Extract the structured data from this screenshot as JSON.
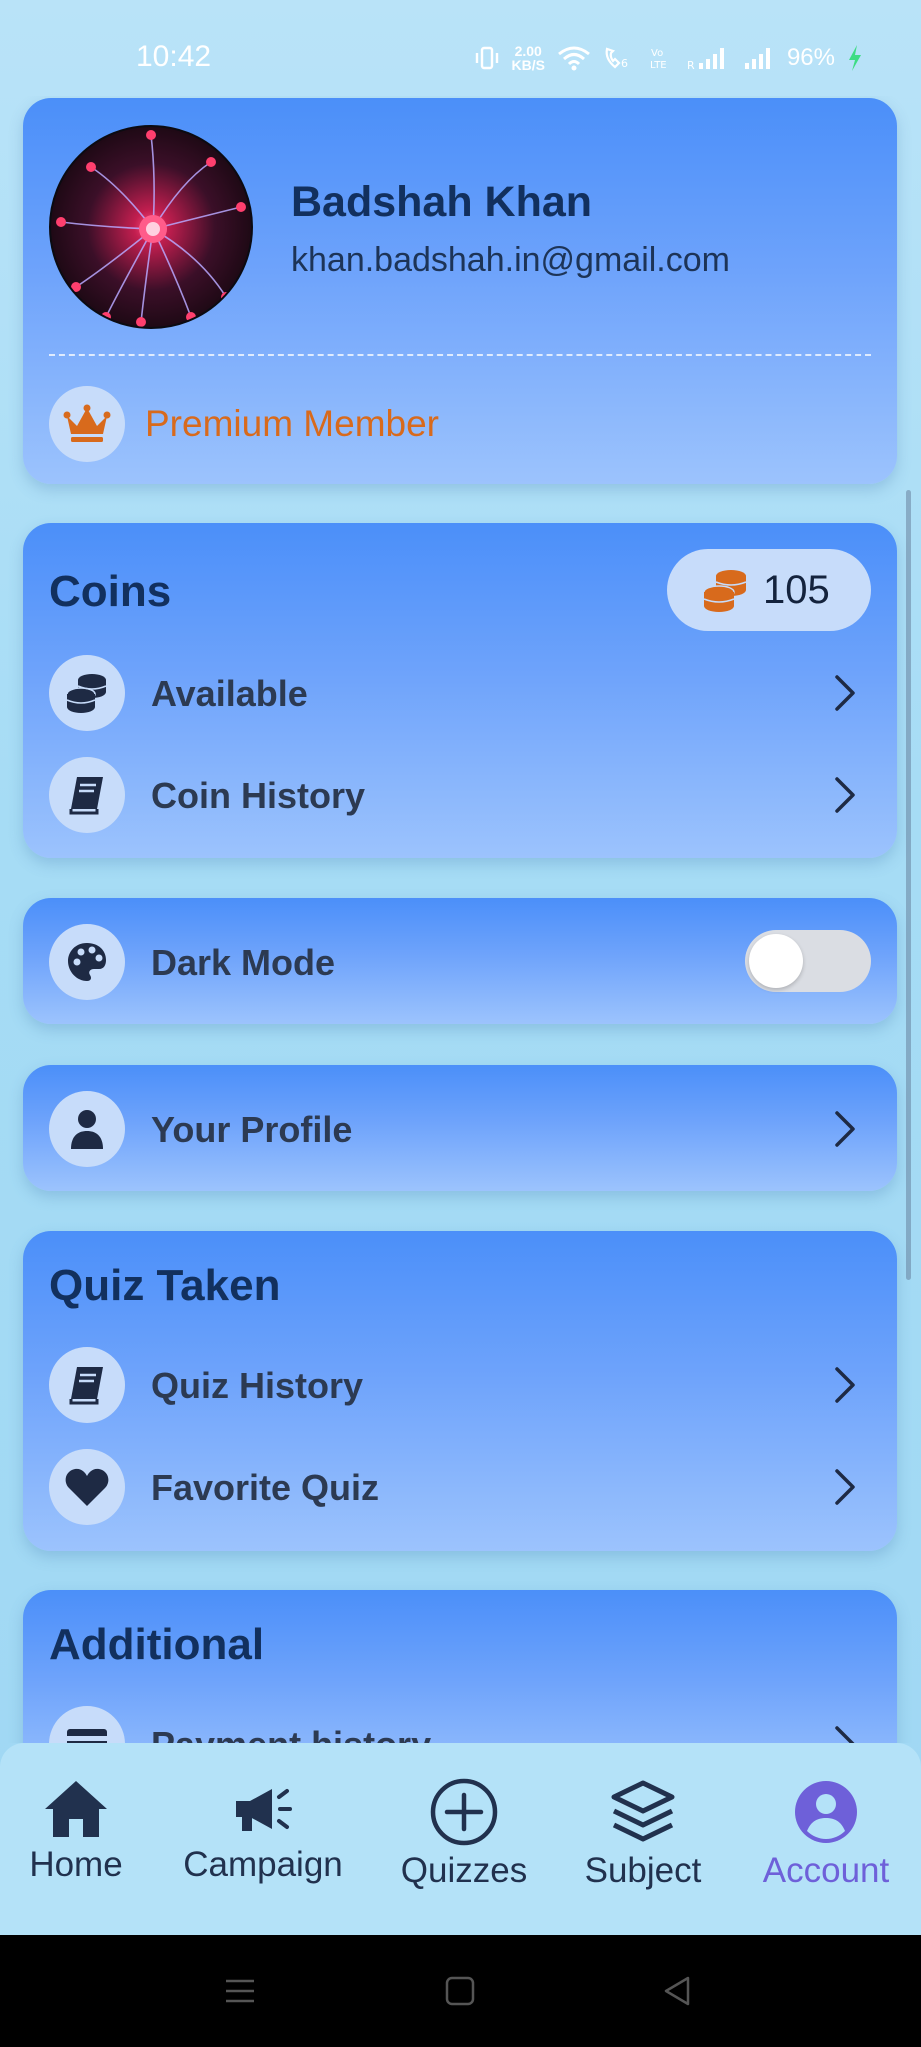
{
  "status_bar": {
    "time": "10:42",
    "net_speed_value": "2.00",
    "net_speed_unit": "KB/S",
    "battery": "96%"
  },
  "profile": {
    "name": "Badshah Khan",
    "email": "khan.badshah.in@gmail.com",
    "membership": "Premium Member",
    "membership_icon": "crown-icon"
  },
  "coins": {
    "title": "Coins",
    "count": "105",
    "items": [
      {
        "label": "Available",
        "icon": "coins-stack-icon"
      },
      {
        "label": "Coin History",
        "icon": "book-icon"
      }
    ]
  },
  "appearance": {
    "dark_mode_label": "Dark Mode",
    "dark_mode_on": false,
    "icon": "palette-icon"
  },
  "account": {
    "profile_label": "Your Profile",
    "icon": "user-icon"
  },
  "quiz": {
    "title": "Quiz Taken",
    "items": [
      {
        "label": "Quiz History",
        "icon": "book-icon"
      },
      {
        "label": "Favorite Quiz",
        "icon": "heart-icon"
      }
    ]
  },
  "additional": {
    "title": "Additional",
    "items": [
      {
        "label": "Payment history",
        "icon": "card-icon"
      }
    ]
  },
  "bottom_nav": {
    "items": [
      {
        "label": "Home",
        "icon": "home-icon"
      },
      {
        "label": "Campaign",
        "icon": "megaphone-icon"
      },
      {
        "label": "Quizzes",
        "icon": "plus-circle-icon"
      },
      {
        "label": "Subject",
        "icon": "layers-icon"
      },
      {
        "label": "Account",
        "icon": "account-circle-icon"
      }
    ],
    "active": "Account",
    "active_color": "#6e60d9"
  },
  "colors": {
    "card_gradient_top": "#4b8ff9",
    "card_gradient_bottom": "#9cc3fd",
    "premium_accent": "#d86a1c",
    "text_dark": "#12305e"
  }
}
